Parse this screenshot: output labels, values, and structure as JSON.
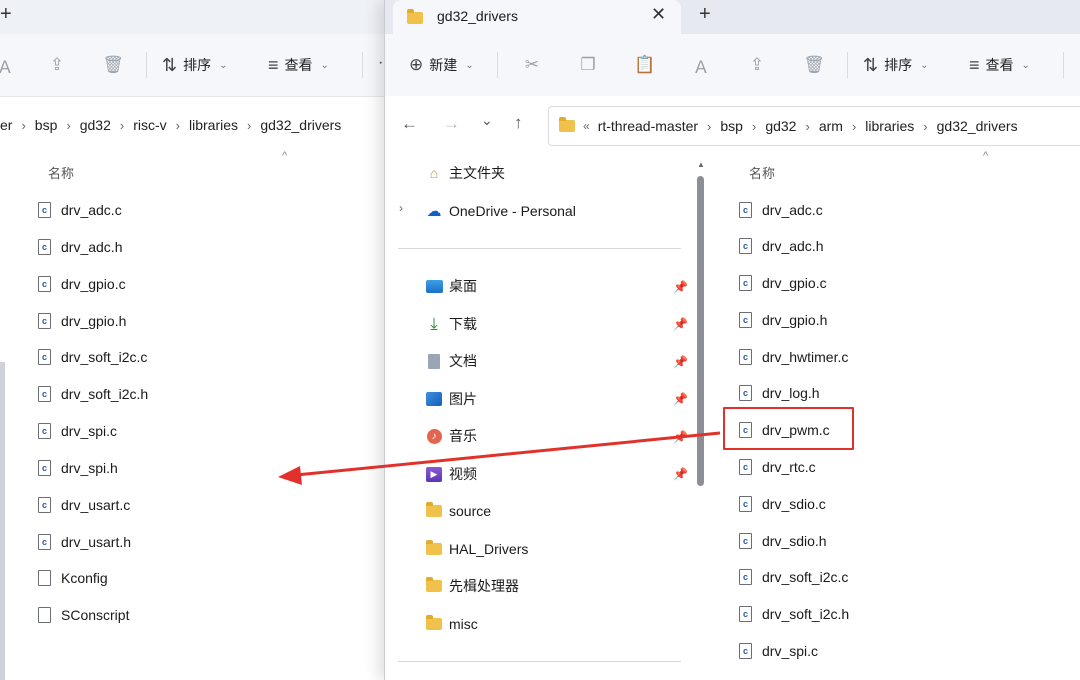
{
  "left_window": {
    "toolbar": {
      "sort_label": "排序",
      "view_label": "查看"
    },
    "breadcrumb": [
      "er",
      "bsp",
      "gd32",
      "risc-v",
      "libraries",
      "gd32_drivers"
    ],
    "column_header": "名称",
    "files": [
      {
        "name": "drv_adc.c",
        "type": "c"
      },
      {
        "name": "drv_adc.h",
        "type": "c"
      },
      {
        "name": "drv_gpio.c",
        "type": "c"
      },
      {
        "name": "drv_gpio.h",
        "type": "c"
      },
      {
        "name": "drv_soft_i2c.c",
        "type": "c"
      },
      {
        "name": "drv_soft_i2c.h",
        "type": "c"
      },
      {
        "name": "drv_spi.c",
        "type": "c"
      },
      {
        "name": "drv_spi.h",
        "type": "c"
      },
      {
        "name": "drv_usart.c",
        "type": "c"
      },
      {
        "name": "drv_usart.h",
        "type": "c"
      },
      {
        "name": "Kconfig",
        "type": "plain"
      },
      {
        "name": "SConscript",
        "type": "plain"
      }
    ]
  },
  "right_window": {
    "tab_title": "gd32_drivers",
    "toolbar": {
      "new_label": "新建",
      "sort_label": "排序",
      "view_label": "查看"
    },
    "breadcrumb": [
      "rt-thread-master",
      "bsp",
      "gd32",
      "arm",
      "libraries",
      "gd32_drivers"
    ],
    "nav_pane": {
      "home": "主文件夹",
      "onedrive": "OneDrive - Personal",
      "quick_access": [
        {
          "label": "桌面",
          "icon": "desktop-icon",
          "pinned": true
        },
        {
          "label": "下载",
          "icon": "download-icon",
          "pinned": true
        },
        {
          "label": "文档",
          "icon": "document-icon",
          "pinned": true
        },
        {
          "label": "图片",
          "icon": "pictures-icon",
          "pinned": true
        },
        {
          "label": "音乐",
          "icon": "music-icon",
          "pinned": true
        },
        {
          "label": "视频",
          "icon": "video-icon",
          "pinned": true
        },
        {
          "label": "source",
          "icon": "folder-icon",
          "pinned": false
        },
        {
          "label": "HAL_Drivers",
          "icon": "folder-icon",
          "pinned": false
        },
        {
          "label": "先楫处理器",
          "icon": "folder-icon",
          "pinned": false
        },
        {
          "label": "misc",
          "icon": "folder-icon",
          "pinned": false
        }
      ]
    },
    "column_header": "名称",
    "files": [
      {
        "name": "drv_adc.c"
      },
      {
        "name": "drv_adc.h"
      },
      {
        "name": "drv_gpio.c"
      },
      {
        "name": "drv_gpio.h"
      },
      {
        "name": "drv_hwtimer.c"
      },
      {
        "name": "drv_log.h"
      },
      {
        "name": "drv_pwm.c",
        "highlighted": true
      },
      {
        "name": "drv_rtc.c"
      },
      {
        "name": "drv_sdio.c"
      },
      {
        "name": "drv_sdio.h"
      },
      {
        "name": "drv_soft_i2c.c"
      },
      {
        "name": "drv_soft_i2c.h"
      },
      {
        "name": "drv_spi.c"
      }
    ]
  },
  "colors": {
    "annotation": "#e0322b",
    "folder": "#f0c14b",
    "accent": "#0067c0"
  }
}
